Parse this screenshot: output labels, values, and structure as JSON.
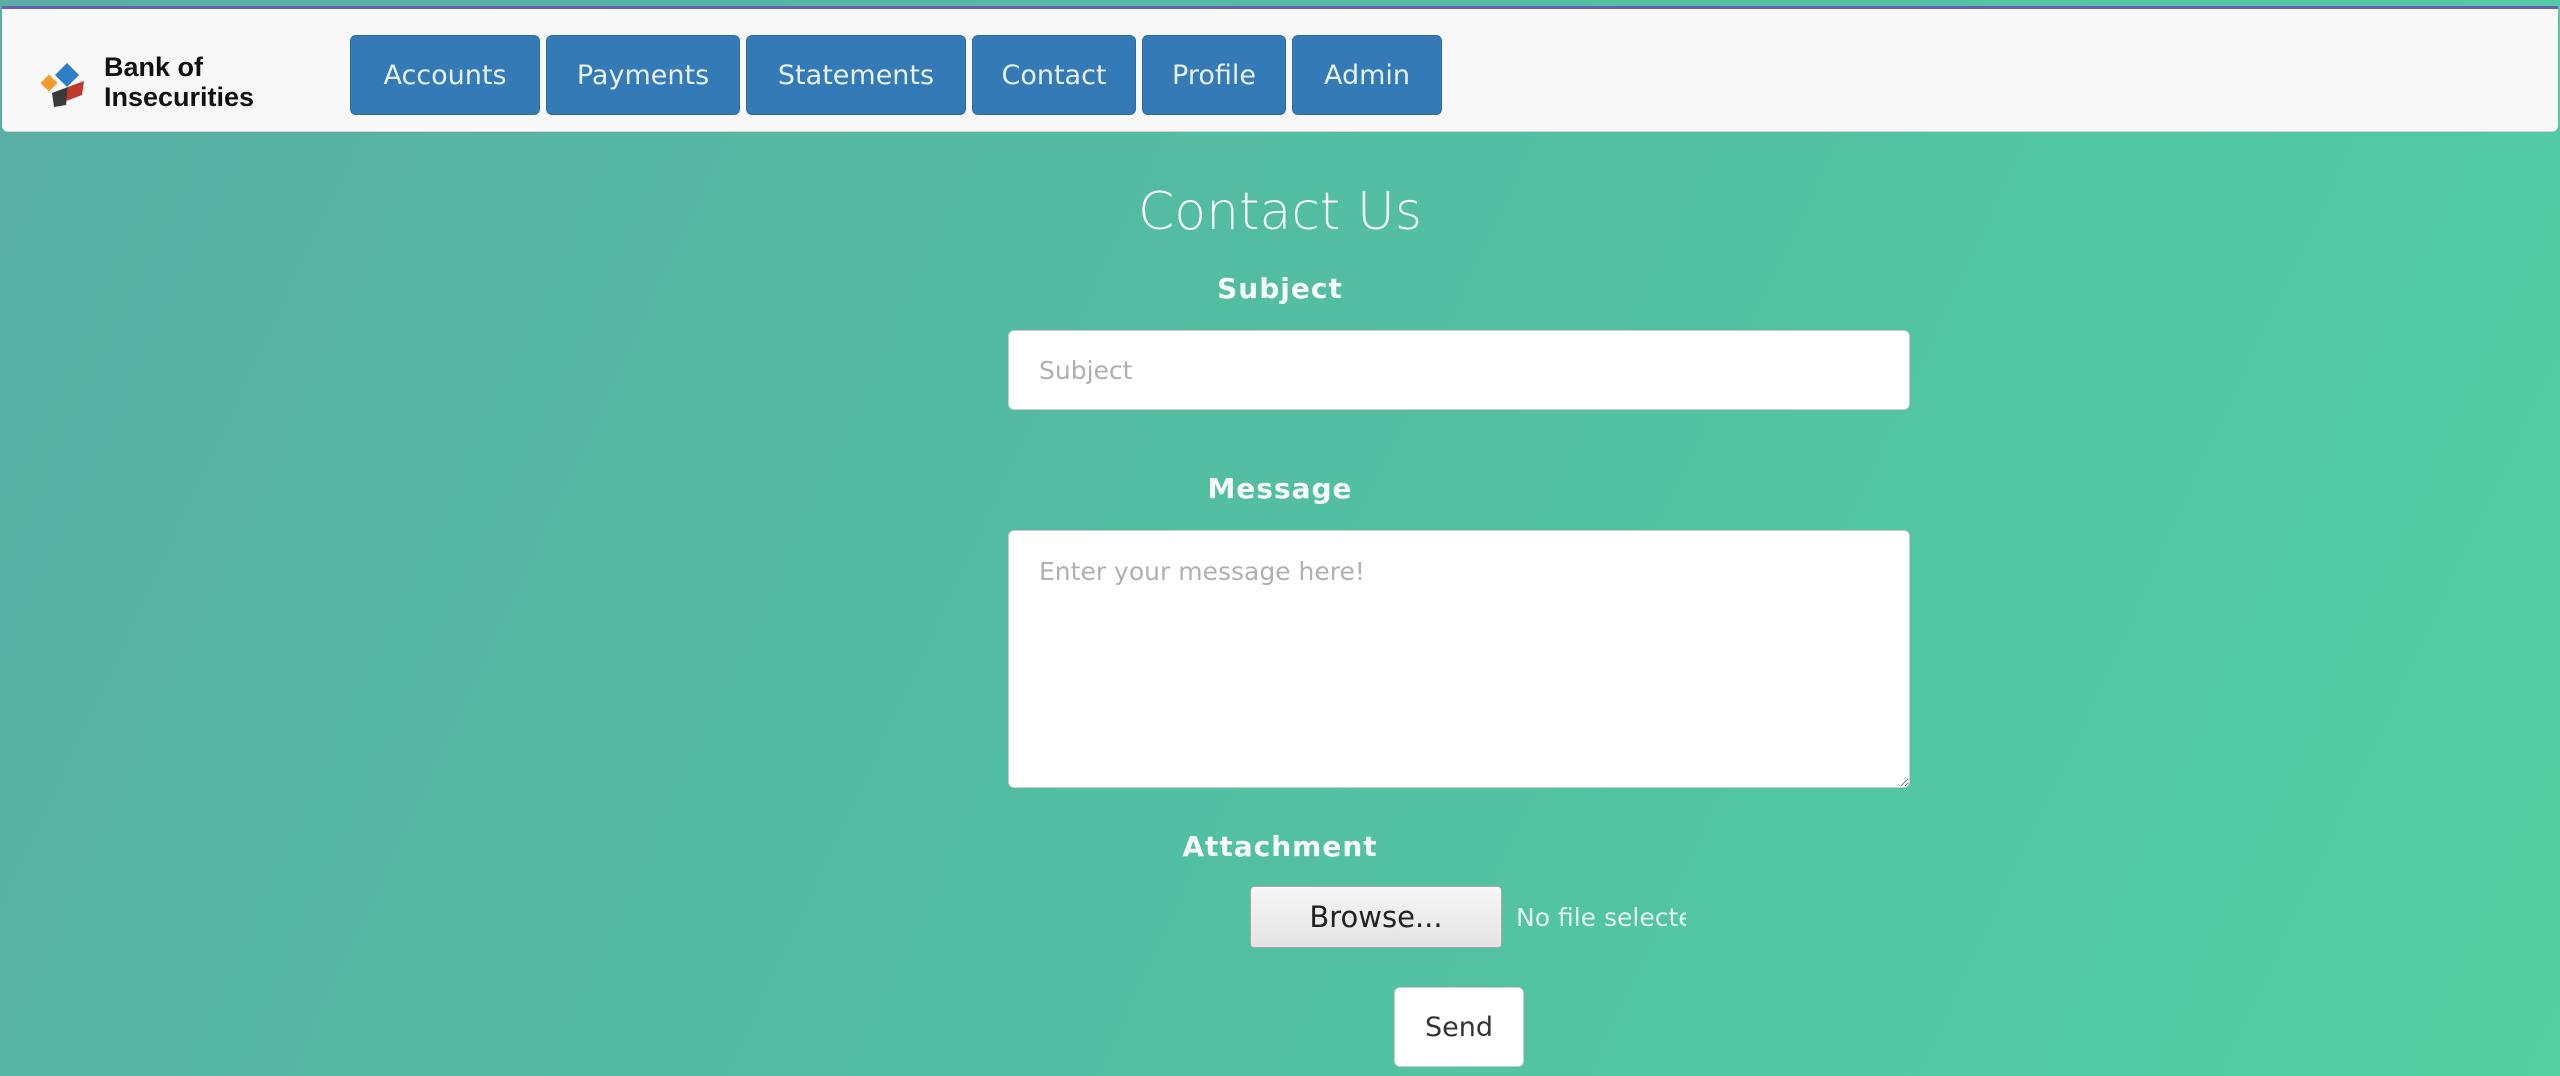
{
  "brand": {
    "line1": "Bank of",
    "line2": "Insecurities",
    "logo_icon": "bank-logo-icon",
    "logo_colors": [
      "#2e7fc4",
      "#f39c2b",
      "#3a3a3a",
      "#c0392b"
    ]
  },
  "nav": {
    "items": [
      {
        "label": "Accounts"
      },
      {
        "label": "Payments"
      },
      {
        "label": "Statements"
      },
      {
        "label": "Contact"
      },
      {
        "label": "Profile"
      },
      {
        "label": "Admin"
      }
    ],
    "button_color": "#337ab7",
    "bar_accent": "#6a5fb8"
  },
  "page": {
    "title": "Contact Us"
  },
  "form": {
    "subject_label": "Subject",
    "subject_placeholder": "Subject",
    "subject_value": "",
    "message_label": "Message",
    "message_placeholder": "Enter your message here!",
    "message_value": "",
    "attachment_label": "Attachment",
    "browse_label": "Browse...",
    "file_status": "No file selected.",
    "send_label": "Send"
  },
  "theme": {
    "background_gradient": [
      "#5aaea5",
      "#52cfa3"
    ]
  }
}
